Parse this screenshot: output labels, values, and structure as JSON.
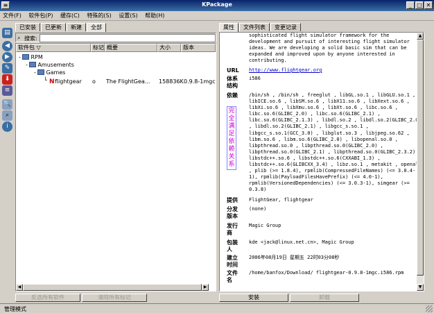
{
  "window": {
    "title": "KPackage",
    "minimize": "_",
    "maximize": "□",
    "close": "✕"
  },
  "menu": [
    "文件(F)",
    "软件包(P)",
    "缓存(C)",
    "特殊的(S)",
    "设置(S)",
    "帮助(H)"
  ],
  "toolbar_icons": [
    "open-icon",
    "back-icon",
    "forward-icon",
    "edit-icon",
    "install-icon",
    "uninstall-icon",
    "find-icon",
    "find-file-icon",
    "info-icon"
  ],
  "left_tabs": [
    "已安装",
    "已更新",
    "新建",
    "全部"
  ],
  "search": {
    "label": "搜索:",
    "value": "",
    "placeholder": ""
  },
  "columns": [
    "软件包",
    "标记",
    "概要",
    "大小",
    "版本"
  ],
  "tree": [
    {
      "label": "RPM",
      "level": 0,
      "expander": "-"
    },
    {
      "label": "Amusements",
      "level": 1,
      "expander": "-"
    },
    {
      "label": "Games",
      "level": 2,
      "expander": "-"
    }
  ],
  "package": {
    "name": "flightgear",
    "mark": "o",
    "summary": "The FlightGea...",
    "size": "158836K",
    "version": "0.9.8-1mgc"
  },
  "left_buttons": {
    "mark_all": "反选所有软件",
    "unmark_all": "清除所有标记"
  },
  "right_tabs": [
    "属性",
    "文件列表",
    "变更记录"
  ],
  "annotation": "完全满足依赖关系",
  "details": {
    "description": "sophisticated flight simulator framework for the development and pursuit of interesting flight simulator ideas. We are developing a solid basic sim that can be expanded and improved upon by anyone interested in contributing.",
    "fields": [
      {
        "label": "URL",
        "value": "http://www.flightgear.org",
        "link": true
      },
      {
        "label": "体系结构",
        "value": "i586"
      },
      {
        "label": "依赖",
        "value": "/bin/sh , /bin/sh , freeglut , libGL.so.1 , libGLU.so.1 , libICE.so.6 , libSM.so.6 , libX11.so.6 , libXext.so.6 , libXi.so.6 , libXmu.so.6 , libXt.so.6 , libc.so.6 , libc.so.6(GLIBC_2.0) , libc.so.6(GLIBC_2.1) , libc.so.6(GLIBC_2.1.3) , libdl.so.2 , libdl.so.2(GLIBC_2.0) , libdl.so.2(GLIBC_2.1) , libgcc_s.so.1 , libgcc_s.so.1(GCC_3.0) , libglut.so.3 , libjpeg.so.62 , libm.so.6 , libm.so.6(GLIBC_2.0) , libopenal.so.0 , libpthread.so.0 , libpthread.so.0(GLIBC_2.0) , libpthread.so.0(GLIBC_2.1) , libpthread.so.0(GLIBC_2.3.2) , libstdc++.so.6 , libstdc++.so.6(CXXABI_1.3) , libstdc++.so.6(GLIBCXX_3.4) , libz.so.1 , metakit , openal , plib (>= 1.8.4), rpmlib(CompressedFileNames) (<= 3.0.4-1), rpmlib(PayloadFilesHavePrefix) (<= 4.0-1), rpmlib(VersionedDependencies) (<= 3.0.3-1), simgear (>= 0.3.8)"
      },
      {
        "label": "提供",
        "value": "FlightGear, flightgear"
      },
      {
        "label": "分发版本",
        "value": "(none)"
      },
      {
        "label": "发行商",
        "value": "Magic Group"
      },
      {
        "label": "包装人",
        "value": "kde <jack@linux.net.cn>, Magic Group"
      },
      {
        "label": "建立时间",
        "value": "2006年08月19日 星期五 22时03分08秒"
      },
      {
        "label": "文件名",
        "value": "/home/banfox/Download/ flightgear-0.9.8-1mgc.i586.rpm"
      }
    ]
  },
  "right_buttons": {
    "install": "安装",
    "uninstall": "卸载"
  },
  "status": "管理模式",
  "colors": {
    "title_bg": "#0a246a",
    "chrome": "#d4d0c8",
    "link": "#0000cc",
    "annotation": "#cc00cc"
  }
}
